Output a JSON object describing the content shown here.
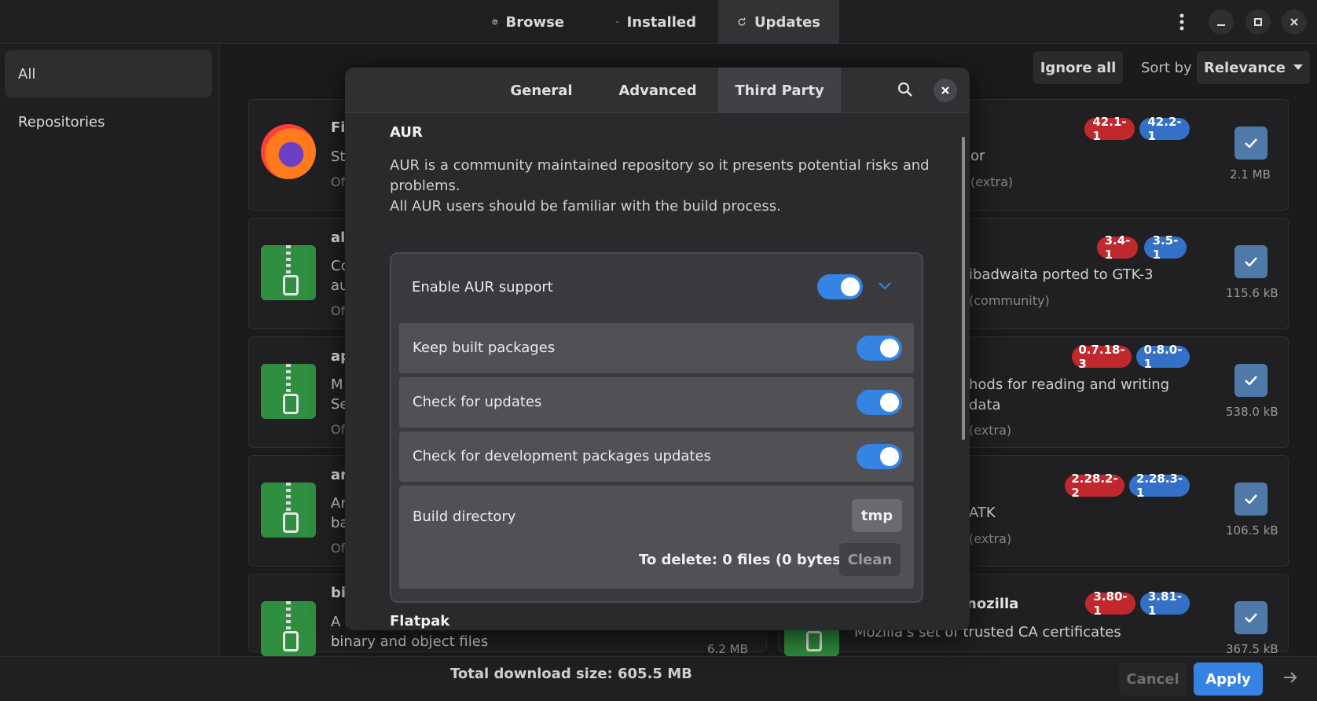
{
  "header": {
    "tabs": [
      {
        "label": "Browse",
        "icon": "globe-icon"
      },
      {
        "label": "Installed",
        "icon": "list-icon"
      },
      {
        "label": "Updates",
        "icon": "refresh-icon"
      }
    ]
  },
  "sidebar": {
    "items": [
      {
        "label": "All"
      },
      {
        "label": "Repositories"
      }
    ]
  },
  "toolbar": {
    "ignore_all": "Ignore all",
    "sort_by": "Sort by",
    "sort_value": "Relevance"
  },
  "list": {
    "left_fragments": [
      {
        "name": "Fi",
        "line1": "St",
        "line2": "Of"
      },
      {
        "name": "al",
        "line1": "Co",
        "line1b": "au",
        "line2": "Of"
      },
      {
        "name": "ap",
        "line1": "M",
        "line1b": "Se",
        "line2": "Of"
      },
      {
        "name": "ar",
        "line1": "Ar",
        "line1b": "ba",
        "line2": "Of"
      },
      {
        "name": "bi",
        "line1": "A s",
        "line1b": "binary and object files"
      }
    ],
    "left_bottom_size": "6.2 MB",
    "right_items": [
      {
        "desc": "or",
        "repo": "(extra)",
        "old": "42.1-1",
        "new": "42.2-1",
        "size": "2.1 MB"
      },
      {
        "desc": "ibadwaita ported to GTK-3",
        "repo": "(community)",
        "old": "3.4-1",
        "new": "3.5-1",
        "size": "115.6 kB"
      },
      {
        "desc": "hods for reading and writing",
        "desc2": "data",
        "repo": "(extra)",
        "old": "0.7.18-3",
        "new": "0.8.0-1",
        "size": "538.0 kB"
      },
      {
        "desc": "ATK",
        "repo": "(extra)",
        "old": "2.28.2-2",
        "new": "2.28.3-1",
        "size": "106.5 kB"
      },
      {
        "name": "nozilla",
        "desc": "Mozilla's set of trusted CA certificates",
        "old": "3.80-1",
        "new": "3.81-1",
        "size": "367.5 kB"
      }
    ]
  },
  "bottom": {
    "total": "Total download size: 605.5 MB",
    "cancel": "Cancel",
    "apply": "Apply"
  },
  "dialog": {
    "tabs": [
      "General",
      "Advanced",
      "Third Party"
    ],
    "aur": {
      "title": "AUR",
      "desc_line1": "AUR is a community maintained repository so it presents potential risks and",
      "desc_line2": "problems.",
      "desc_line3": "All AUR users should be familiar with the build process.",
      "enable_label": "Enable AUR support",
      "enable_on": true,
      "options": [
        {
          "label": "Keep built packages",
          "on": true
        },
        {
          "label": "Check for updates",
          "on": true
        },
        {
          "label": "Check for development packages updates",
          "on": true
        }
      ],
      "build_dir_label": "Build directory",
      "build_dir_value": "tmp",
      "to_delete_label": "To delete:",
      "to_delete_files": "0 files",
      "to_delete_bytes": "(0 bytes)",
      "clean": "Clean"
    },
    "flatpak_title": "Flatpak"
  },
  "colors": {
    "accent": "#3584e4",
    "old_badge": "#c0282e",
    "new_badge": "#3470c7"
  }
}
